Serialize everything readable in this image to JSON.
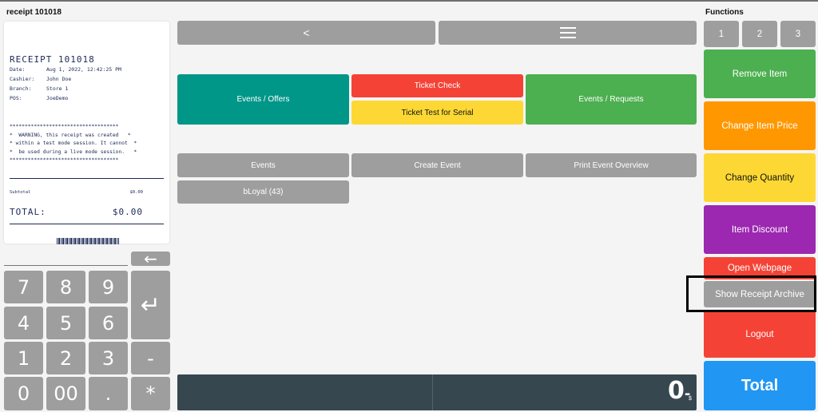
{
  "header": {
    "receipt_label": "receipt 101018",
    "functions_label": "Functions"
  },
  "receipt": {
    "title": "RECEIPT  101018",
    "date_label": "Date:",
    "date_value": "Aug 1, 2022, 12:42:25 PM",
    "cashier_label": "Cashier:",
    "cashier_value": "John Doe",
    "branch_label": "Branch:",
    "branch_value": "Store 1",
    "pos_label": "POS:",
    "pos_value": "JoeDemo",
    "warning": "************************************\n*  WARNING, this receipt was created   *\n* within a test mode session. It cannot  *\n*  be used during a live mode session.   *\n************************************",
    "subtotal_label": "Subtotal",
    "subtotal_value": "$0.00",
    "total_label": "TOTAL:",
    "total_value": "$0.00"
  },
  "numpad": {
    "back_arrow": "←",
    "enter": "↵",
    "keys": {
      "k7": "7",
      "k8": "8",
      "k9": "9",
      "k4": "4",
      "k5": "5",
      "k6": "6",
      "k1": "1",
      "k2": "2",
      "k3": "3",
      "minus": "-",
      "k0": "0",
      "k00": "00",
      "dot": ".",
      "star": "*"
    }
  },
  "nav": {
    "back": "<",
    "menu": "☰"
  },
  "center": {
    "events_offers": "Events / Offers",
    "ticket_check": "Ticket Check",
    "ticket_test": "Ticket Test for Serial",
    "events_requests": "Events / Requests",
    "events": "Events",
    "create_event": "Create Event",
    "print_event_overview": "Print Event Overview",
    "bloyal": "bLoyal (43)"
  },
  "total_display": {
    "value": "0",
    "suffix": "-",
    "currency": "$"
  },
  "functions": {
    "tabs": [
      "1",
      "2",
      "3"
    ],
    "remove_item": "Remove Item",
    "change_item_price": "Change Item Price",
    "change_quantity": "Change Quantity",
    "item_discount": "Item Discount",
    "open_webpage": "Open Webpage",
    "show_receipt_archive": "Show Receipt Archive",
    "logout": "Logout",
    "total": "Total"
  },
  "colors": {
    "teal": "#009688",
    "red": "#f44336",
    "yellow": "#fdd835",
    "green": "#4caf50",
    "orange": "#ff9800",
    "purple": "#9c27b0",
    "blue": "#2196f3",
    "grey": "#9e9e9e",
    "dark": "#37474f"
  }
}
